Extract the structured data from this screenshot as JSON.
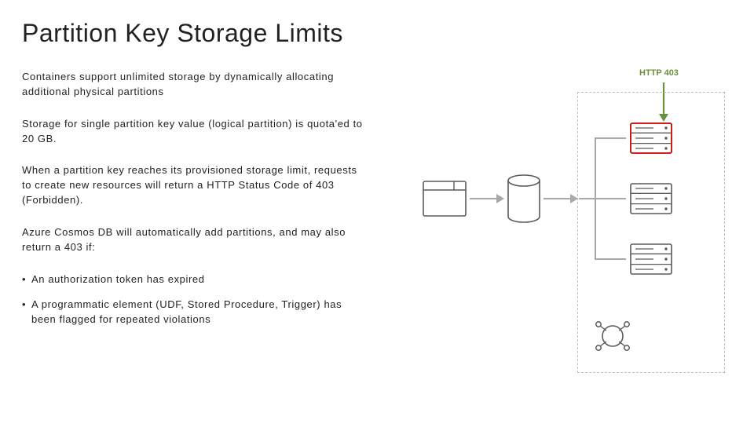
{
  "title": "Partition Key Storage Limits",
  "paragraphs": {
    "p1": "Containers support unlimited storage by dynamically allocating additional physical partitions",
    "p2": "Storage for single partition key value (logical partition) is quota'ed to 20 GB.",
    "p3": "When a partition key reaches its provisioned storage limit, requests to create new resources will return a HTTP Status Code of 403 (Forbidden).",
    "p4": "Azure Cosmos DB will automatically add partitions, and may also return a 403 if:"
  },
  "bullets": {
    "b1": "An authorization token has expired",
    "b2": "A programmatic element (UDF, Stored Procedure, Trigger) has been flagged for repeated violations"
  },
  "diagram": {
    "http_label": "HTTP 403"
  }
}
